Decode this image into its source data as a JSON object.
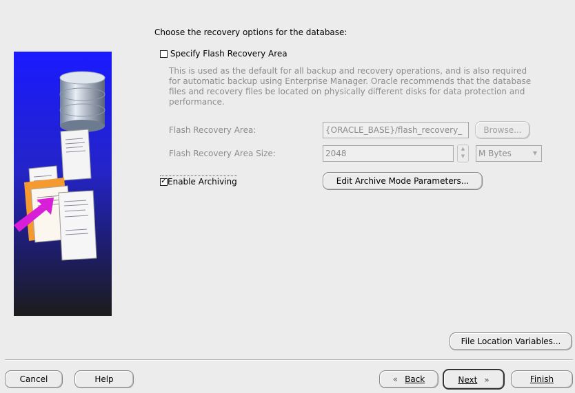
{
  "main": {
    "heading": "Choose the recovery options for the database:",
    "flash_checkbox": {
      "label": "Specify Flash Recovery Area",
      "checked": false
    },
    "description_lines": [
      "This is used as the default for all backup and recovery operations, and is also required",
      "for automatic backup using Enterprise Manager. Oracle recommends that the database",
      "files and recovery files be located on physically different disks for data protection and",
      "performance."
    ],
    "flash_area": {
      "label": "Flash Recovery Area:",
      "value": "{ORACLE_BASE}/flash_recovery_",
      "browse_label": "Browse..."
    },
    "flash_size": {
      "label": "Flash Recovery Area Size:",
      "value": "2048",
      "unit": "M Bytes"
    },
    "archiving_checkbox": {
      "label": "Enable Archiving",
      "checked": true
    },
    "archive_params_label": "Edit Archive Mode Parameters...",
    "file_location_label": "File Location Variables..."
  },
  "footer": {
    "cancel_label": "Cancel",
    "help_label": "Help",
    "back_label": "Back",
    "next_label": "Next",
    "finish_label": "Finish"
  },
  "colors": {
    "window_bg": "#ececec",
    "illustration_top": "#1a1aff",
    "illustration_bottom": "#1c1c1c",
    "arrow": "#d91ed9",
    "disabled_text": "#8c8c8c"
  },
  "icons": {
    "back": "chevron-left-icon",
    "next": "chevron-right-icon",
    "spinner": "spinner-arrows-icon",
    "dropdown": "chevron-down-icon"
  }
}
